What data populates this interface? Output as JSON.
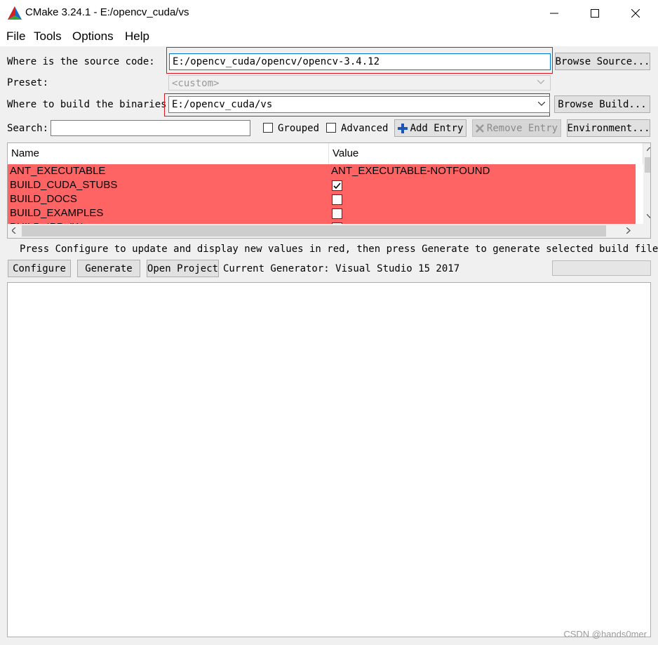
{
  "window": {
    "title": "CMake 3.24.1 - E:/opencv_cuda/vs"
  },
  "menu": [
    "File",
    "Tools",
    "Options",
    "Help"
  ],
  "source": {
    "label": "Where is the source code:",
    "value": "E:/opencv_cuda/opencv/opencv-3.4.12",
    "browse": "Browse Source..."
  },
  "preset": {
    "label": "Preset:",
    "value": "<custom>"
  },
  "build": {
    "label": "Where to build the binaries:",
    "value": "E:/opencv_cuda/vs",
    "browse": "Browse Build..."
  },
  "search": {
    "label": "Search:",
    "value": ""
  },
  "options": {
    "grouped": "Grouped",
    "advanced": "Advanced",
    "add_entry": "Add Entry",
    "remove_entry": "Remove Entry",
    "environment": "Environment..."
  },
  "table": {
    "columns": [
      "Name",
      "Value"
    ],
    "rows": [
      {
        "name": "ANT_EXECUTABLE",
        "value": "ANT_EXECUTABLE-NOTFOUND",
        "type": "text"
      },
      {
        "name": "BUILD_CUDA_STUBS",
        "value": "",
        "type": "checkbox",
        "checked": true
      },
      {
        "name": "BUILD_DOCS",
        "value": "",
        "type": "checkbox",
        "checked": false
      },
      {
        "name": "BUILD_EXAMPLES",
        "value": "",
        "type": "checkbox",
        "checked": false
      },
      {
        "name": "BUILD_IPP_IW",
        "value": "",
        "type": "checkbox",
        "checked": false
      }
    ]
  },
  "hint": "Press Configure to update and display new values in red, then press Generate to generate selected build files.",
  "actions": {
    "configure": "Configure",
    "generate": "Generate",
    "open_project": "Open Project",
    "generator": "Current Generator: Visual Studio 15 2017"
  },
  "watermark": "CSDN @hands0mer",
  "colors": {
    "changed_row": "#ff6464",
    "highlight_box": "#e0141e"
  }
}
